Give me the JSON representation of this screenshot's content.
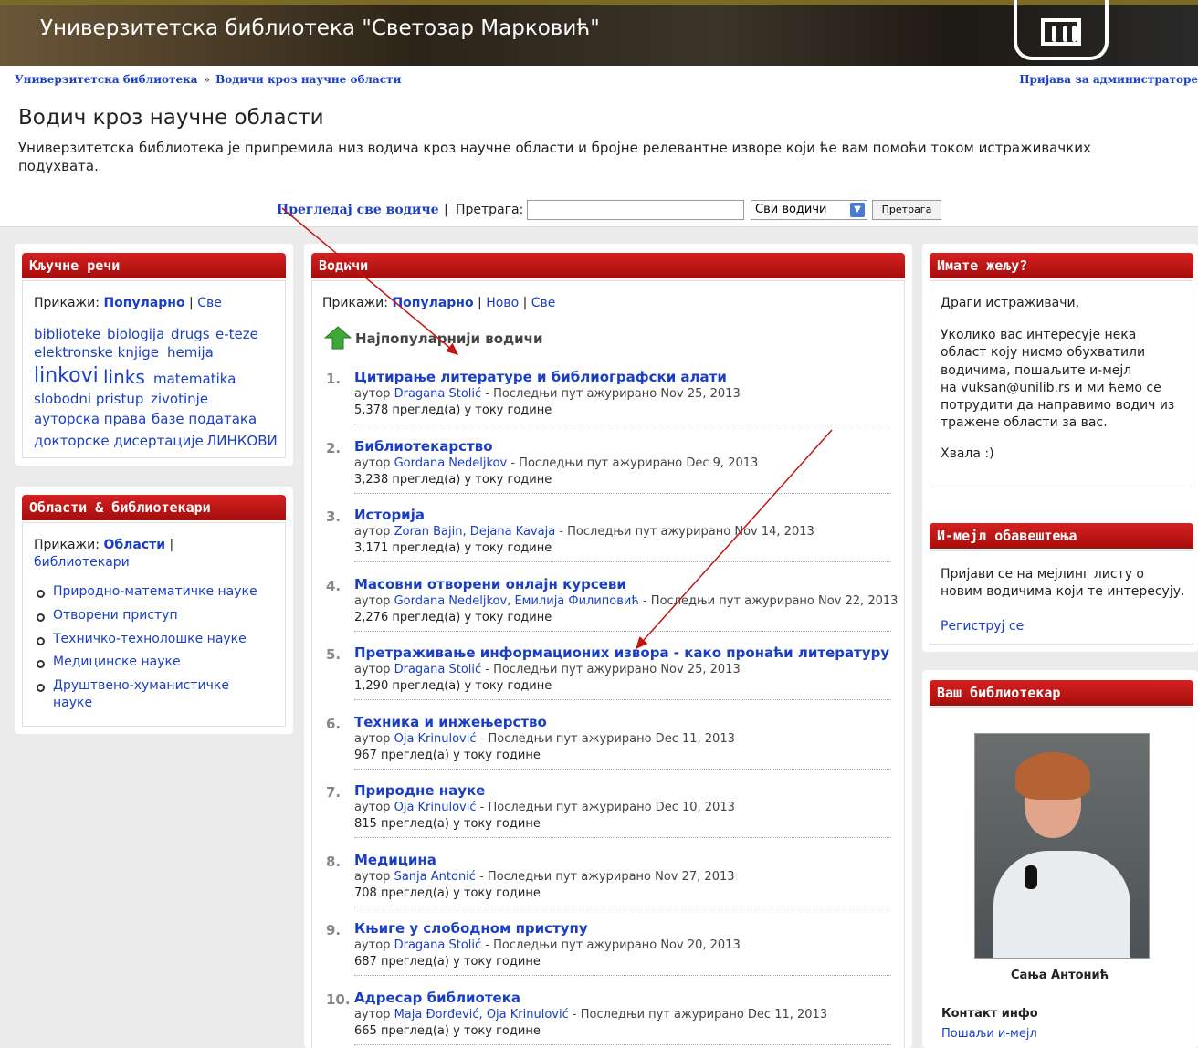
{
  "banner": {
    "title": "Универзитетска библиотека \"Светозар Марковић\""
  },
  "breadcrumb": {
    "home": "Универзитетска библиотека",
    "sep": "»",
    "current": "Водичи кроз научне области"
  },
  "admin_link": "Пријава за администраторе",
  "page": {
    "title": "Водич кроз научне области",
    "intro_line1": "Универзитетска библиотека је припремила низ водича кроз научне области и бројне релевантне изворе који ће вам помоћи током истраживачких",
    "intro_line2": "подухвата."
  },
  "search": {
    "browse_all": "Прегледај све водиче",
    "sep": "|",
    "label": "Претрага:",
    "input_value": "",
    "scope_selected": "Сви водичи",
    "button": "Претрага"
  },
  "keywords": {
    "header": "Кључне речи",
    "show_label": "Прикажи:",
    "popular": "Популарно",
    "sep": "|",
    "all": "Све",
    "tags": [
      "biblioteke",
      "biologija",
      "drugs",
      "e-teze",
      "elektronske knjige",
      "hemija",
      "linkovi",
      "links",
      "matematika",
      "slobodni pristup",
      "zivotinje",
      "ауторска права",
      "базе података",
      "докторске дисертације",
      "ЛИНКОВИ"
    ]
  },
  "areas": {
    "header": "Области & библиотекари",
    "show_label": "Прикажи:",
    "areas_link": "Области",
    "sep": "|",
    "librarians_link": "библиотекари",
    "items": [
      "Природно-математичке науке",
      "Отворени приступ",
      "Техничко-технолошке науке",
      "Медицинске науке",
      "Друштвено-хуманистичке",
      "науке"
    ]
  },
  "guides": {
    "header": "Водичи",
    "show_label": "Прикажи:",
    "popular": "Популарно",
    "new": "Ново",
    "all": "Све",
    "sep": "|",
    "section_title": "Најпопуларнији водичи",
    "author_prefix": "аутор",
    "items": [
      {
        "num": "1.",
        "title": "Цитирање литературе и библиографски алати",
        "authors": "Dragana Stolić",
        "updated": "- Последњи пут ажурирано Nov 25, 2013",
        "views": "5,378 преглед(а) у току године"
      },
      {
        "num": "2.",
        "title": "Библиотекарство",
        "authors": "Gordana Nedeljkov",
        "updated": "- Последњи пут ажурирано Dec 9, 2013",
        "views": "3,238 преглед(а) у току године"
      },
      {
        "num": "3.",
        "title": "Историја",
        "authors": "Zoran Bajin, Dejana Kavaja",
        "updated": "- Последњи пут ажурирано Nov 14, 2013",
        "views": "3,171 преглед(а) у току године"
      },
      {
        "num": "4.",
        "title": "Масовни отворени онлајн курсеви",
        "authors": "Gordana Nedeljkov, Емилија Филиповић",
        "updated": "- Последњи пут ажурирано Nov 22, 2013",
        "views": "2,276 преглед(а) у току године"
      },
      {
        "num": "5.",
        "title": "Претраживање информационих извора - како пронаћи литературу",
        "authors": "Dragana Stolić",
        "updated": "- Последњи пут ажурирано Nov 25, 2013",
        "views": "1,290 преглед(а) у току године"
      },
      {
        "num": "6.",
        "title": "Техника и инжењерство",
        "authors": "Oja Krinulović",
        "updated": "- Последњи пут ажурирано Dec 11, 2013",
        "views": "967 преглед(а) у току године"
      },
      {
        "num": "7.",
        "title": "Природне науке",
        "authors": "Oja Krinulović",
        "updated": "- Последњи пут ажурирано Dec 10, 2013",
        "views": "815 преглед(а) у току године"
      },
      {
        "num": "8.",
        "title": "Медицина",
        "authors": "Sanja Antonić",
        "updated": "- Последњи пут ажурирано Nov 27, 2013",
        "views": "708 преглед(а) у току године"
      },
      {
        "num": "9.",
        "title": "Књиге у слободном приступу",
        "authors": "Dragana Stolić",
        "updated": "- Последњи пут ажурирано Nov 20, 2013",
        "views": "687 преглед(а) у току године"
      },
      {
        "num": "10.",
        "title": "Адресар библиотека",
        "authors": "Maja Đorđević, Oja Krinulović",
        "updated": "- Последњи пут ажурирано Dec 11, 2013",
        "views": "665 преглед(а) у току године"
      }
    ]
  },
  "wish": {
    "header": "Имате жељу?",
    "greeting": "Драги истраживачи,",
    "body": [
      "Уколико вас интересује нека",
      "област коју нисмо обухватили",
      "водичима, пошаљите и-мејл",
      "на vuksan@unilib.rs и ми ћемо се",
      "потрудити да направимо водич из",
      "тражене области за вас."
    ],
    "thanks": "Хвала :)"
  },
  "email_alerts": {
    "header": "И-мејл обавештења",
    "body": [
      "Пријави се на мејлинг листу о",
      "новим водичима који те интересују."
    ],
    "register": "Региструј се"
  },
  "librarian": {
    "header": "Ваш библиотекар",
    "name": "Сања Антонић",
    "contact_label": "Контакт инфо",
    "send_email": "Пошаљи и-мејл"
  },
  "colors": {
    "panel_header": "#c41515",
    "link": "#1a3fc4",
    "page_bg": "#ebebeb",
    "arrow": "#c41515"
  }
}
